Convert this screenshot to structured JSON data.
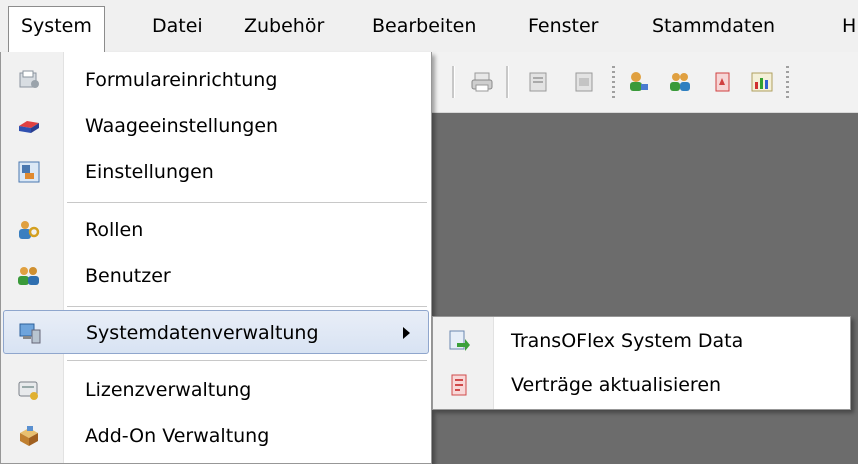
{
  "menubar": {
    "items": [
      {
        "label": "System"
      },
      {
        "label": "Datei"
      },
      {
        "label": "Zubehör"
      },
      {
        "label": "Bearbeiten"
      },
      {
        "label": "Fenster"
      },
      {
        "label": "Stammdaten"
      },
      {
        "label": "H"
      }
    ]
  },
  "system_menu": {
    "items": [
      {
        "label": "Formulareinrichtung",
        "icon": "form-setup-icon"
      },
      {
        "label": "Waageeinstellungen",
        "icon": "scale-icon"
      },
      {
        "label": "Einstellungen",
        "icon": "settings-icon"
      },
      {
        "label": "Rollen",
        "icon": "roles-icon"
      },
      {
        "label": "Benutzer",
        "icon": "users-icon"
      },
      {
        "label": "Systemdatenverwaltung",
        "icon": "system-data-icon"
      },
      {
        "label": "Lizenzverwaltung",
        "icon": "license-icon"
      },
      {
        "label": "Add-On Verwaltung",
        "icon": "addon-icon"
      }
    ]
  },
  "submenu": {
    "items": [
      {
        "label": "TransOFlex System Data",
        "icon": "transoflex-data-icon"
      },
      {
        "label": "Verträge aktualisieren",
        "icon": "contracts-update-icon"
      }
    ]
  },
  "colors": {
    "workspace": "#6c6c6c",
    "highlight_border": "#8fa6cd",
    "menu_gutter": "#f1f1f1"
  }
}
